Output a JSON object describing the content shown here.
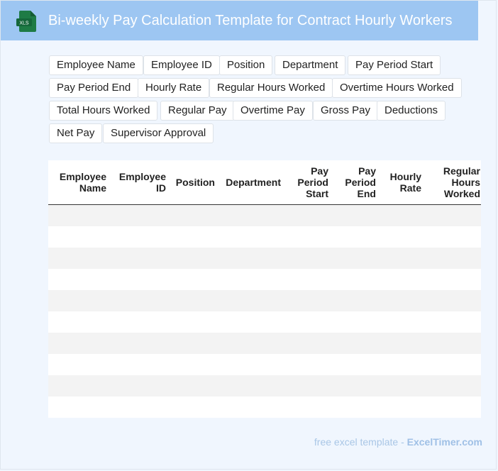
{
  "header": {
    "title": "Bi-weekly Pay Calculation Template for Contract Hourly Workers",
    "icon_label": "XLS",
    "bg_color": "#9dc6f2"
  },
  "tags": [
    "Employee Name",
    "Employee ID",
    "Position",
    "Department",
    "Pay Period Start",
    "Pay Period End",
    "Hourly Rate",
    "Regular Hours Worked",
    "Overtime Hours Worked",
    "Total Hours Worked",
    "Regular Pay",
    "Overtime Pay",
    "Gross Pay",
    "Deductions",
    "Net Pay",
    "Supervisor Approval"
  ],
  "table": {
    "columns": [
      [
        "Employee",
        "Name"
      ],
      [
        "Employee",
        "ID"
      ],
      [
        "Position"
      ],
      [
        "Department"
      ],
      [
        "Pay",
        "Period",
        "Start"
      ],
      [
        "Pay",
        "Period",
        "End"
      ],
      [
        "Hourly",
        "Rate"
      ],
      [
        "Regular",
        "Hours",
        "Worked"
      ]
    ],
    "rows": 10
  },
  "footer": {
    "prefix": "free excel template - ",
    "brand": "ExcelTimer.com"
  }
}
